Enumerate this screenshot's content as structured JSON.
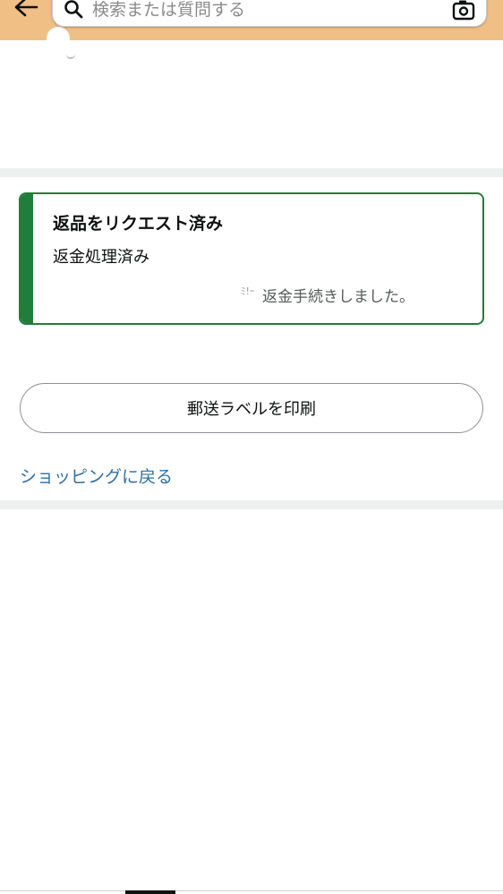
{
  "header": {
    "search": {
      "placeholder": "検索または質問する",
      "value": ""
    },
    "icons": {
      "back": "arrow-left-icon",
      "search": "search-icon",
      "camera": "camera-icon"
    },
    "colors": {
      "background": "#f0bf86"
    }
  },
  "status_card": {
    "title": "返品をリクエスト済み",
    "subtitle": "返金処理済み",
    "detail_fragment": "ﾐ!ｰ",
    "detail": "返金手続きしました。",
    "accent_color": "#1f7f3a"
  },
  "actions": {
    "print_label": "郵送ラベルを印刷",
    "back_to_shopping": "ショッピングに戻る"
  }
}
